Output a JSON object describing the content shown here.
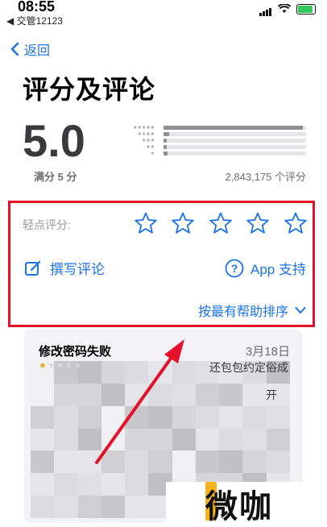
{
  "status_bar": {
    "time": "08:55",
    "carrier": "◀ 交管12123"
  },
  "nav": {
    "back_label": "返回"
  },
  "header": {
    "title": "评分及评论"
  },
  "summary": {
    "score": "5.0",
    "out_of": "满分 5 分",
    "rating_count": "2,843,175 个评分",
    "distribution": [
      0.98,
      0.04,
      0.02,
      0.02,
      0.03
    ]
  },
  "rate": {
    "tap_label": "轻点评分:",
    "star_count": 5
  },
  "actions": {
    "write_review": "撰写评论",
    "app_support": "App 支持",
    "sort": "按最有帮助排序"
  },
  "review": {
    "title": "修改密码失败",
    "date": "3月18日",
    "rating": 1,
    "text_fragment1": "还包包约定俗成",
    "text_fragment2": "开"
  },
  "watermark": {
    "text": "微咖"
  },
  "colors": {
    "accent": "#1a73e8",
    "highlight_box": "#e5102a",
    "arrow": "#e5102a"
  }
}
